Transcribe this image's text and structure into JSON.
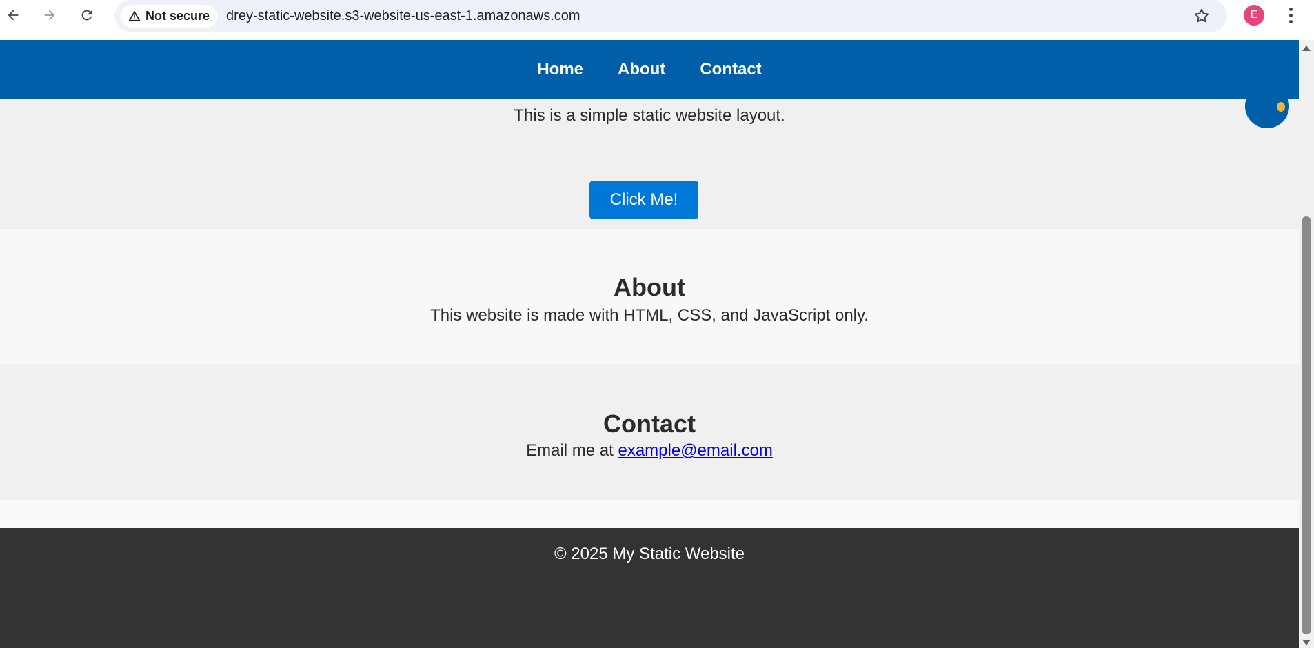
{
  "browser": {
    "security_label": "Not secure",
    "url": "drey-static-website.s3-website-us-east-1.amazonaws.com",
    "profile_initial": "E"
  },
  "site": {
    "nav": [
      {
        "label": "Home"
      },
      {
        "label": "About"
      },
      {
        "label": "Contact"
      }
    ],
    "hero": {
      "text": "This is a simple static website layout.",
      "button_label": "Click Me!"
    },
    "about": {
      "heading": "About",
      "text": "This website is made with HTML, CSS, and JavaScript only."
    },
    "contact": {
      "heading": "Contact",
      "prefix": "Email me at ",
      "email": "example@email.com"
    },
    "footer": {
      "text": "© 2025 My Static Website"
    }
  },
  "colors": {
    "header_bg": "#005fa8",
    "button_bg": "#0078d7",
    "footer_bg": "#333333",
    "link": "#0000ee"
  }
}
